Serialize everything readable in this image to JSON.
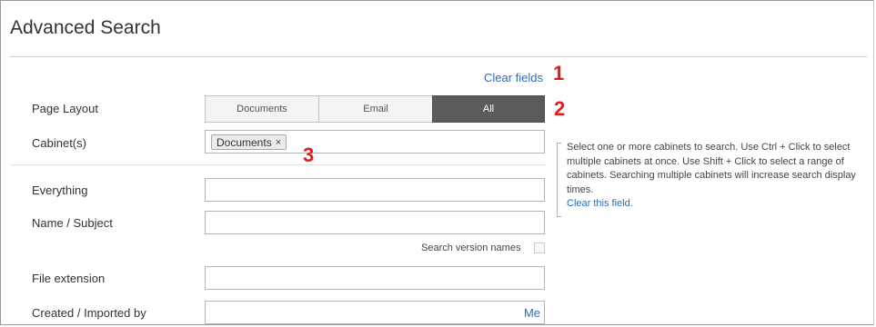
{
  "title": "Advanced Search",
  "clear_fields": "Clear fields",
  "markers": [
    "1",
    "2",
    "3"
  ],
  "page_layout": {
    "label": "Page Layout",
    "options": [
      "Documents",
      "Email",
      "All"
    ],
    "selected": "All"
  },
  "cabinets": {
    "label": "Cabinet(s)",
    "chip": "Documents",
    "chip_remove": "×"
  },
  "help": {
    "text": "Select one or more cabinets to search. Use Ctrl + Click to select multiple cabinets at once. Use Shift + Click to select a range of cabinets. Searching multiple cabinets will increase search display times.",
    "link": "Clear this field."
  },
  "fields": {
    "everything": "Everything",
    "name_subject": "Name / Subject",
    "search_version_names": "Search version names",
    "file_extension": "File extension",
    "created_imported_by": "Created / Imported by",
    "me": "Me"
  }
}
